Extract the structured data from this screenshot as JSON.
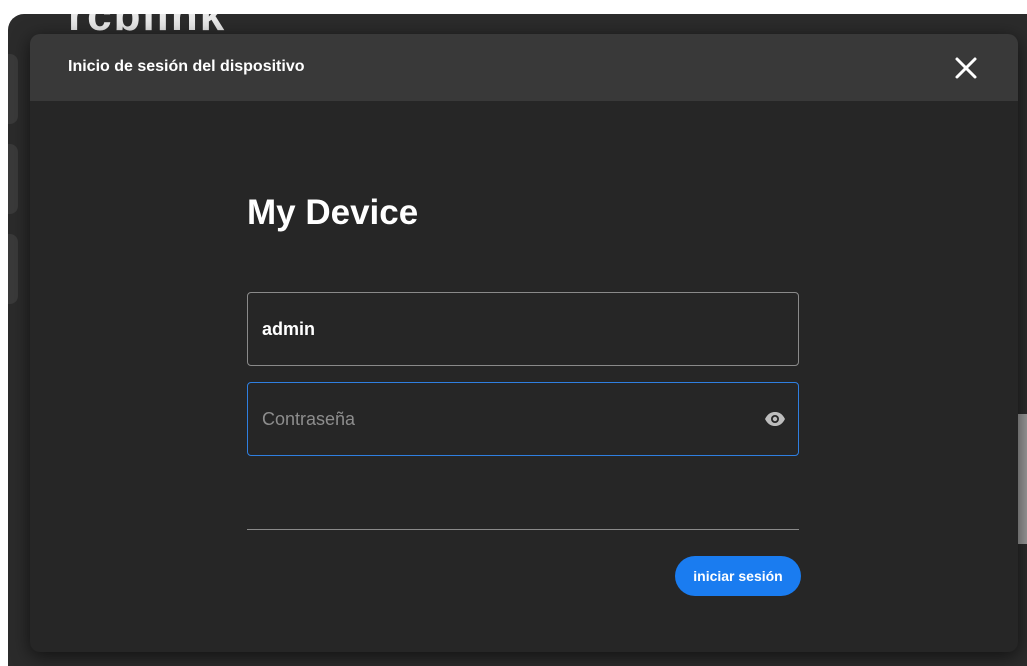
{
  "background": {
    "logo_text": "rcblink"
  },
  "modal": {
    "title": "Inicio de sesión del dispositivo",
    "close_icon": "close-icon",
    "device_name": "My Device",
    "username": {
      "value": "admin"
    },
    "password": {
      "value": "",
      "placeholder": "Contraseña",
      "toggle_icon": "eye-icon"
    },
    "login_button_label": "iniciar sesión"
  },
  "colors": {
    "modal_bg": "#262626",
    "header_bg": "#393939",
    "accent": "#1a7cf0",
    "focus_border": "#2f7fe0"
  }
}
